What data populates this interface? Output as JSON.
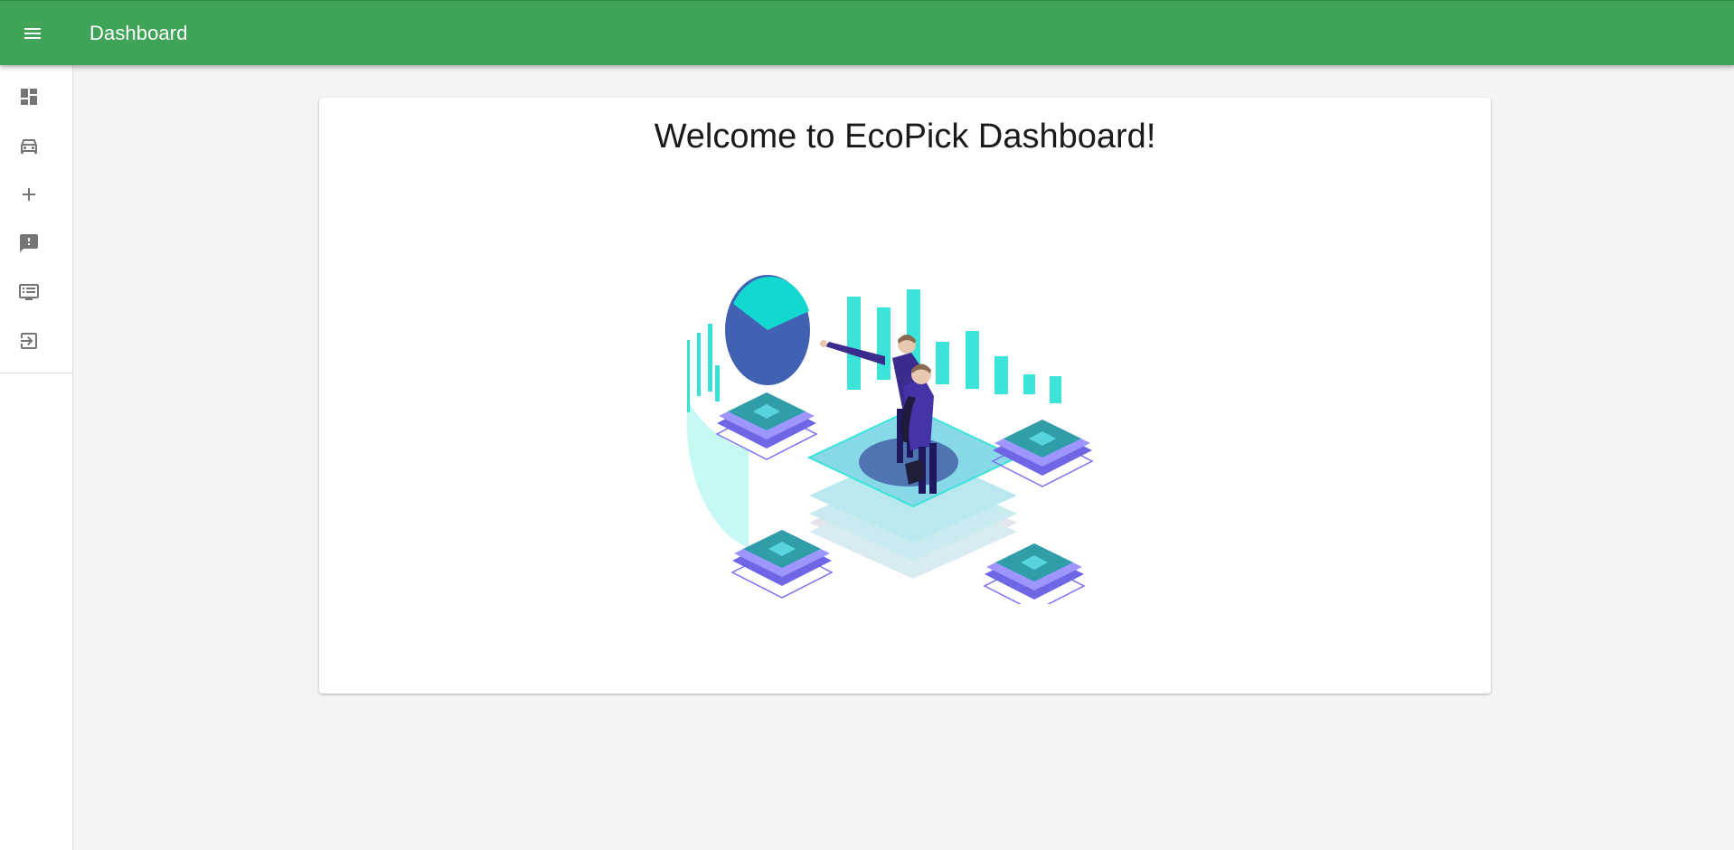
{
  "appbar": {
    "title": "Dashboard",
    "menu_icon": "menu-icon",
    "background": "#3fa358"
  },
  "sidebar": {
    "items": [
      {
        "name": "dashboard",
        "icon": "dashboard-icon"
      },
      {
        "name": "vehicles",
        "icon": "car-icon"
      },
      {
        "name": "add",
        "icon": "add-icon"
      },
      {
        "name": "feedback",
        "icon": "feedback-icon"
      },
      {
        "name": "list",
        "icon": "list-icon"
      },
      {
        "name": "logout",
        "icon": "logout-icon"
      }
    ]
  },
  "main": {
    "welcome_title": "Welcome to EcoPick Dashboard!",
    "illustration": "business-analytics-illustration"
  }
}
